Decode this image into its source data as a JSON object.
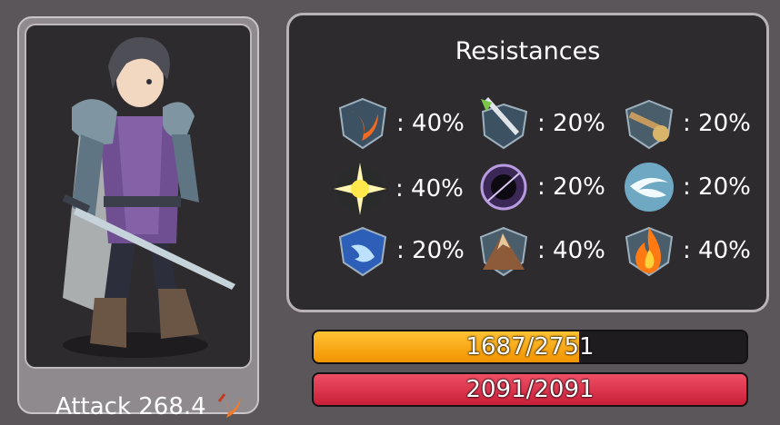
{
  "colors": {
    "background": "#5b5659",
    "panel": "#2e2b2f",
    "energy": "#f5a000",
    "health": "#e0304a"
  },
  "character": {
    "attack_label": "Attack 268.4",
    "attack_icon": "slash-icon"
  },
  "resistances": {
    "title": "Resistances",
    "items": [
      {
        "icon": "slash-shield-icon",
        "value": ": 40%"
      },
      {
        "icon": "pierce-arrow-icon",
        "value": ": 20%"
      },
      {
        "icon": "mace-icon",
        "value": ": 20%"
      },
      {
        "icon": "light-burst-icon",
        "value": ": 40%"
      },
      {
        "icon": "dark-vortex-icon",
        "value": ": 20%"
      },
      {
        "icon": "wind-swirl-icon",
        "value": ": 20%"
      },
      {
        "icon": "water-drop-icon",
        "value": ": 20%"
      },
      {
        "icon": "earth-mountain-icon",
        "value": ": 40%"
      },
      {
        "icon": "fire-flame-icon",
        "value": ": 40%"
      }
    ]
  },
  "bars": {
    "energy": {
      "text": "1687/2751",
      "fraction": 0.613
    },
    "health": {
      "text": "2091/2091",
      "fraction": 1.0
    }
  }
}
